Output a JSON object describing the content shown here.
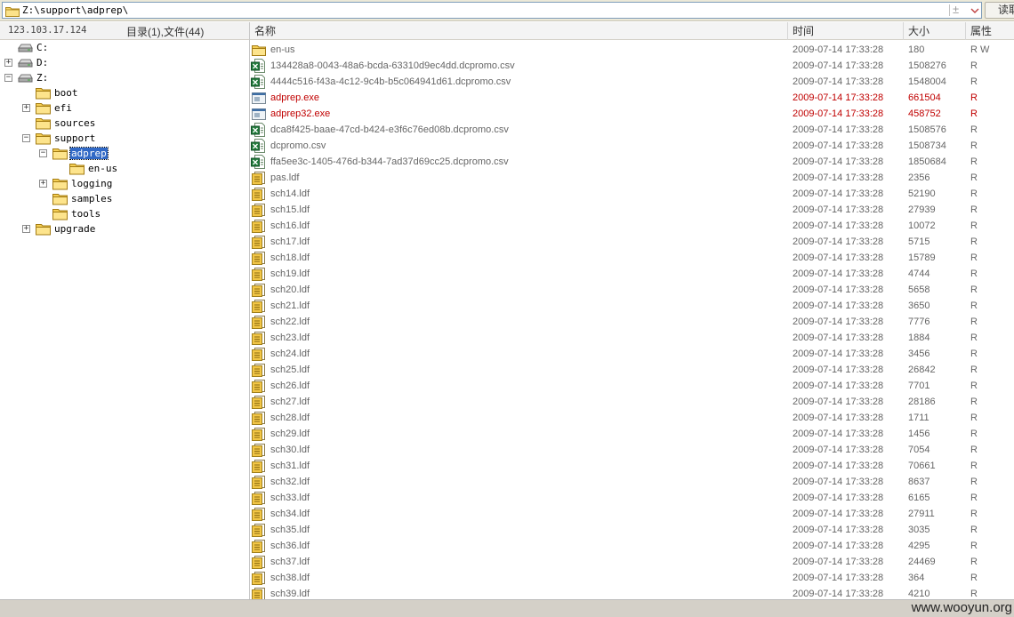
{
  "address": {
    "path": "Z:\\support\\adprep\\",
    "read_button": "读取"
  },
  "left_header": {
    "host": "123.103.17.124",
    "summary": "目录(1),文件(44)"
  },
  "tree": [
    {
      "label": "C:",
      "type": "drive",
      "level": 0,
      "expander": ""
    },
    {
      "label": "D:",
      "type": "drive",
      "level": 0,
      "expander": "+"
    },
    {
      "label": "Z:",
      "type": "drive",
      "level": 0,
      "expander": "-"
    },
    {
      "label": "boot",
      "type": "folder",
      "level": 1,
      "expander": ""
    },
    {
      "label": "efi",
      "type": "folder",
      "level": 1,
      "expander": "+"
    },
    {
      "label": "sources",
      "type": "folder",
      "level": 1,
      "expander": ""
    },
    {
      "label": "support",
      "type": "folder",
      "level": 1,
      "expander": "-"
    },
    {
      "label": "adprep",
      "type": "folder",
      "level": 2,
      "expander": "-",
      "selected": true
    },
    {
      "label": "en-us",
      "type": "folder",
      "level": 3,
      "expander": ""
    },
    {
      "label": "logging",
      "type": "folder",
      "level": 2,
      "expander": "+"
    },
    {
      "label": "samples",
      "type": "folder",
      "level": 2,
      "expander": ""
    },
    {
      "label": "tools",
      "type": "folder",
      "level": 2,
      "expander": ""
    },
    {
      "label": "upgrade",
      "type": "folder",
      "level": 1,
      "expander": "+"
    }
  ],
  "columns": {
    "name": "名称",
    "time": "时间",
    "size": "大小",
    "attr": "属性"
  },
  "files": [
    {
      "name": "en-us",
      "icon": "folder",
      "time": "2009-07-14 17:33:28",
      "size": "180",
      "attr": "R W"
    },
    {
      "name": "134428a8-0043-48a6-bcda-63310d9ec4dd.dcpromo.csv",
      "icon": "excel",
      "time": "2009-07-14 17:33:28",
      "size": "1508276",
      "attr": "R"
    },
    {
      "name": "4444c516-f43a-4c12-9c4b-b5c064941d61.dcpromo.csv",
      "icon": "excel",
      "time": "2009-07-14 17:33:28",
      "size": "1548004",
      "attr": "R"
    },
    {
      "name": "adprep.exe",
      "icon": "exe",
      "time": "2009-07-14 17:33:28",
      "size": "661504",
      "attr": "R",
      "highlight": true
    },
    {
      "name": "adprep32.exe",
      "icon": "exe",
      "time": "2009-07-14 17:33:28",
      "size": "458752",
      "attr": "R",
      "highlight": true
    },
    {
      "name": "dca8f425-baae-47cd-b424-e3f6c76ed08b.dcpromo.csv",
      "icon": "excel",
      "time": "2009-07-14 17:33:28",
      "size": "1508576",
      "attr": "R"
    },
    {
      "name": "dcpromo.csv",
      "icon": "excel",
      "time": "2009-07-14 17:33:28",
      "size": "1508734",
      "attr": "R"
    },
    {
      "name": "ffa5ee3c-1405-476d-b344-7ad37d69cc25.dcpromo.csv",
      "icon": "excel",
      "time": "2009-07-14 17:33:28",
      "size": "1850684",
      "attr": "R"
    },
    {
      "name": "pas.ldf",
      "icon": "ldf",
      "time": "2009-07-14 17:33:28",
      "size": "2356",
      "attr": "R"
    },
    {
      "name": "sch14.ldf",
      "icon": "ldf",
      "time": "2009-07-14 17:33:28",
      "size": "52190",
      "attr": "R"
    },
    {
      "name": "sch15.ldf",
      "icon": "ldf",
      "time": "2009-07-14 17:33:28",
      "size": "27939",
      "attr": "R"
    },
    {
      "name": "sch16.ldf",
      "icon": "ldf",
      "time": "2009-07-14 17:33:28",
      "size": "10072",
      "attr": "R"
    },
    {
      "name": "sch17.ldf",
      "icon": "ldf",
      "time": "2009-07-14 17:33:28",
      "size": "5715",
      "attr": "R"
    },
    {
      "name": "sch18.ldf",
      "icon": "ldf",
      "time": "2009-07-14 17:33:28",
      "size": "15789",
      "attr": "R"
    },
    {
      "name": "sch19.ldf",
      "icon": "ldf",
      "time": "2009-07-14 17:33:28",
      "size": "4744",
      "attr": "R"
    },
    {
      "name": "sch20.ldf",
      "icon": "ldf",
      "time": "2009-07-14 17:33:28",
      "size": "5658",
      "attr": "R"
    },
    {
      "name": "sch21.ldf",
      "icon": "ldf",
      "time": "2009-07-14 17:33:28",
      "size": "3650",
      "attr": "R"
    },
    {
      "name": "sch22.ldf",
      "icon": "ldf",
      "time": "2009-07-14 17:33:28",
      "size": "7776",
      "attr": "R"
    },
    {
      "name": "sch23.ldf",
      "icon": "ldf",
      "time": "2009-07-14 17:33:28",
      "size": "1884",
      "attr": "R"
    },
    {
      "name": "sch24.ldf",
      "icon": "ldf",
      "time": "2009-07-14 17:33:28",
      "size": "3456",
      "attr": "R"
    },
    {
      "name": "sch25.ldf",
      "icon": "ldf",
      "time": "2009-07-14 17:33:28",
      "size": "26842",
      "attr": "R"
    },
    {
      "name": "sch26.ldf",
      "icon": "ldf",
      "time": "2009-07-14 17:33:28",
      "size": "7701",
      "attr": "R"
    },
    {
      "name": "sch27.ldf",
      "icon": "ldf",
      "time": "2009-07-14 17:33:28",
      "size": "28186",
      "attr": "R"
    },
    {
      "name": "sch28.ldf",
      "icon": "ldf",
      "time": "2009-07-14 17:33:28",
      "size": "1711",
      "attr": "R"
    },
    {
      "name": "sch29.ldf",
      "icon": "ldf",
      "time": "2009-07-14 17:33:28",
      "size": "1456",
      "attr": "R"
    },
    {
      "name": "sch30.ldf",
      "icon": "ldf",
      "time": "2009-07-14 17:33:28",
      "size": "7054",
      "attr": "R"
    },
    {
      "name": "sch31.ldf",
      "icon": "ldf",
      "time": "2009-07-14 17:33:28",
      "size": "70661",
      "attr": "R"
    },
    {
      "name": "sch32.ldf",
      "icon": "ldf",
      "time": "2009-07-14 17:33:28",
      "size": "8637",
      "attr": "R"
    },
    {
      "name": "sch33.ldf",
      "icon": "ldf",
      "time": "2009-07-14 17:33:28",
      "size": "6165",
      "attr": "R"
    },
    {
      "name": "sch34.ldf",
      "icon": "ldf",
      "time": "2009-07-14 17:33:28",
      "size": "27911",
      "attr": "R"
    },
    {
      "name": "sch35.ldf",
      "icon": "ldf",
      "time": "2009-07-14 17:33:28",
      "size": "3035",
      "attr": "R"
    },
    {
      "name": "sch36.ldf",
      "icon": "ldf",
      "time": "2009-07-14 17:33:28",
      "size": "4295",
      "attr": "R"
    },
    {
      "name": "sch37.ldf",
      "icon": "ldf",
      "time": "2009-07-14 17:33:28",
      "size": "24469",
      "attr": "R"
    },
    {
      "name": "sch38.ldf",
      "icon": "ldf",
      "time": "2009-07-14 17:33:28",
      "size": "364",
      "attr": "R"
    },
    {
      "name": "sch39.ldf",
      "icon": "ldf",
      "time": "2009-07-14 17:33:28",
      "size": "4210",
      "attr": "R"
    }
  ],
  "colors": {
    "highlight_text": "#c00000",
    "normal_text": "#666666",
    "selection": "#3169c6"
  },
  "status": {
    "watermark": "www.wooyun.org"
  }
}
